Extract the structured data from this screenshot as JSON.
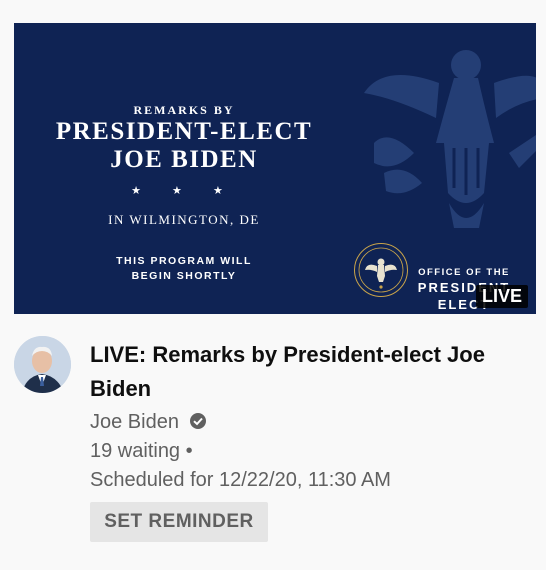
{
  "thumbnail": {
    "remarks_by": "REMARKS BY",
    "title_line1": "PRESIDENT-ELECT",
    "title_line2": "JOE BIDEN",
    "stars": "★ ★ ★",
    "location": "IN WILMINGTON, DE",
    "program_line1": "THIS PROGRAM WILL",
    "program_line2": "BEGIN SHORTLY",
    "office_label": "OFFICE OF THE",
    "office_line2": "PRESIDENT",
    "office_line3": "ELECT",
    "live_badge": "LIVE",
    "colors": {
      "background": "#0f2354",
      "seal_gold": "#c9a44a"
    }
  },
  "video": {
    "title": "LIVE: Remarks by President-elect Joe Biden",
    "channel": "Joe Biden",
    "channel_verified_icon": "verified-check-icon",
    "waiting": "19 waiting •",
    "scheduled": "Scheduled for 12/22/20, 11:30 AM",
    "reminder_label": "SET REMINDER"
  }
}
